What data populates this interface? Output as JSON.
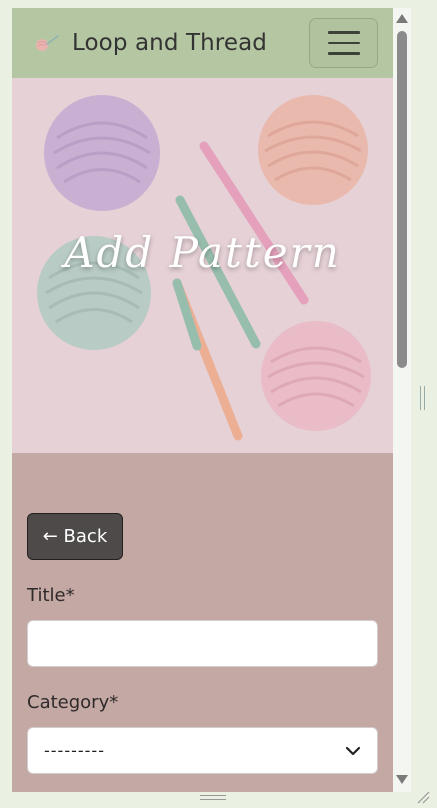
{
  "navbar": {
    "brand_name": "Loop and Thread",
    "menu_icon": "hamburger-menu-icon",
    "colors": {
      "background": "#b5c6a3",
      "text": "#333333"
    }
  },
  "hero": {
    "title": "Add Pattern",
    "image": "yarn-balls-and-crochet-hooks"
  },
  "form": {
    "back_label": "← Back",
    "title_label": "Title*",
    "title_value": "",
    "category_label": "Category*",
    "category_value": "---------",
    "colors": {
      "background": "#c3a8a4",
      "button": "#4f4a4a"
    }
  }
}
